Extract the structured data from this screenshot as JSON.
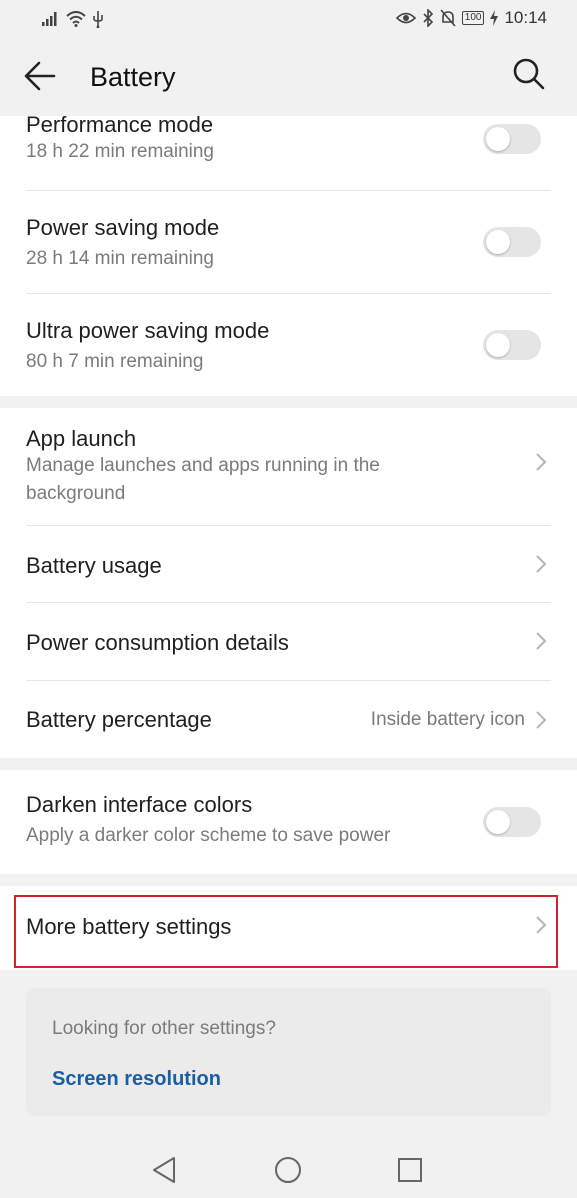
{
  "status_bar": {
    "time": "10:14",
    "battery_level": "100",
    "left_icons": [
      "signal-icon",
      "wifi-icon",
      "usb-icon"
    ],
    "right_icons": [
      "eye-comfort-icon",
      "bluetooth-icon",
      "mute-icon",
      "battery-icon",
      "charging-icon"
    ]
  },
  "app_bar": {
    "title": "Battery"
  },
  "modes": [
    {
      "title": "Performance mode",
      "subtitle": "18 h 22 min remaining",
      "enabled": false
    },
    {
      "title": "Power saving mode",
      "subtitle": "28 h 14 min remaining",
      "enabled": false
    },
    {
      "title": "Ultra power saving mode",
      "subtitle": "80 h 7 min remaining",
      "enabled": false
    }
  ],
  "settings": [
    {
      "title": "App launch",
      "subtitle": "Manage launches and apps running in the background"
    },
    {
      "title": "Battery usage"
    },
    {
      "title": "Power consumption details"
    },
    {
      "title": "Battery percentage",
      "value": "Inside battery icon"
    }
  ],
  "darken": {
    "title": "Darken interface colors",
    "subtitle": "Apply a darker color scheme to save power",
    "enabled": false
  },
  "more": {
    "title": "More battery settings"
  },
  "suggestion": {
    "question": "Looking for other settings?",
    "link": "Screen resolution"
  },
  "colors": {
    "highlight": "#d0252f",
    "link": "#1a5fa6",
    "background": "#f1f1f1"
  }
}
